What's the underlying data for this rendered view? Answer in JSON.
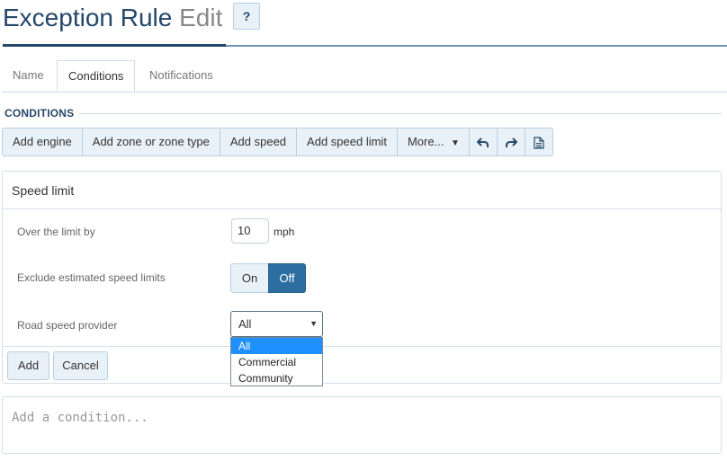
{
  "header": {
    "title": "Exception Rule",
    "subtitle": "Edit",
    "help_label": "?"
  },
  "tabs": [
    {
      "label": "Name",
      "active": false
    },
    {
      "label": "Conditions",
      "active": true
    },
    {
      "label": "Notifications",
      "active": false
    }
  ],
  "section_title": "CONDITIONS",
  "toolbar": {
    "add_engine": "Add engine",
    "add_zone": "Add zone or zone type",
    "add_speed": "Add speed",
    "add_speed_limit": "Add speed limit",
    "more": "More...",
    "undo_icon": "undo-icon",
    "redo_icon": "redo-icon",
    "document_icon": "document-icon"
  },
  "card": {
    "title": "Speed limit",
    "over_limit_label": "Over the limit by",
    "over_limit_value": "10",
    "over_limit_unit": "mph",
    "exclude_label": "Exclude estimated speed limits",
    "toggle_on": "On",
    "toggle_off": "Off",
    "toggle_selected": "Off",
    "provider_label": "Road speed provider",
    "provider_selected": "All",
    "provider_options": [
      "All",
      "Commercial",
      "Community"
    ],
    "add_button": "Add",
    "cancel_button": "Cancel"
  },
  "add_condition_placeholder": "Add a condition...",
  "colors": {
    "primary": "#25476a",
    "toggle_active": "#2d6ea1",
    "option_highlight": "#1e90ff",
    "button_bg": "#e8f1f8"
  }
}
